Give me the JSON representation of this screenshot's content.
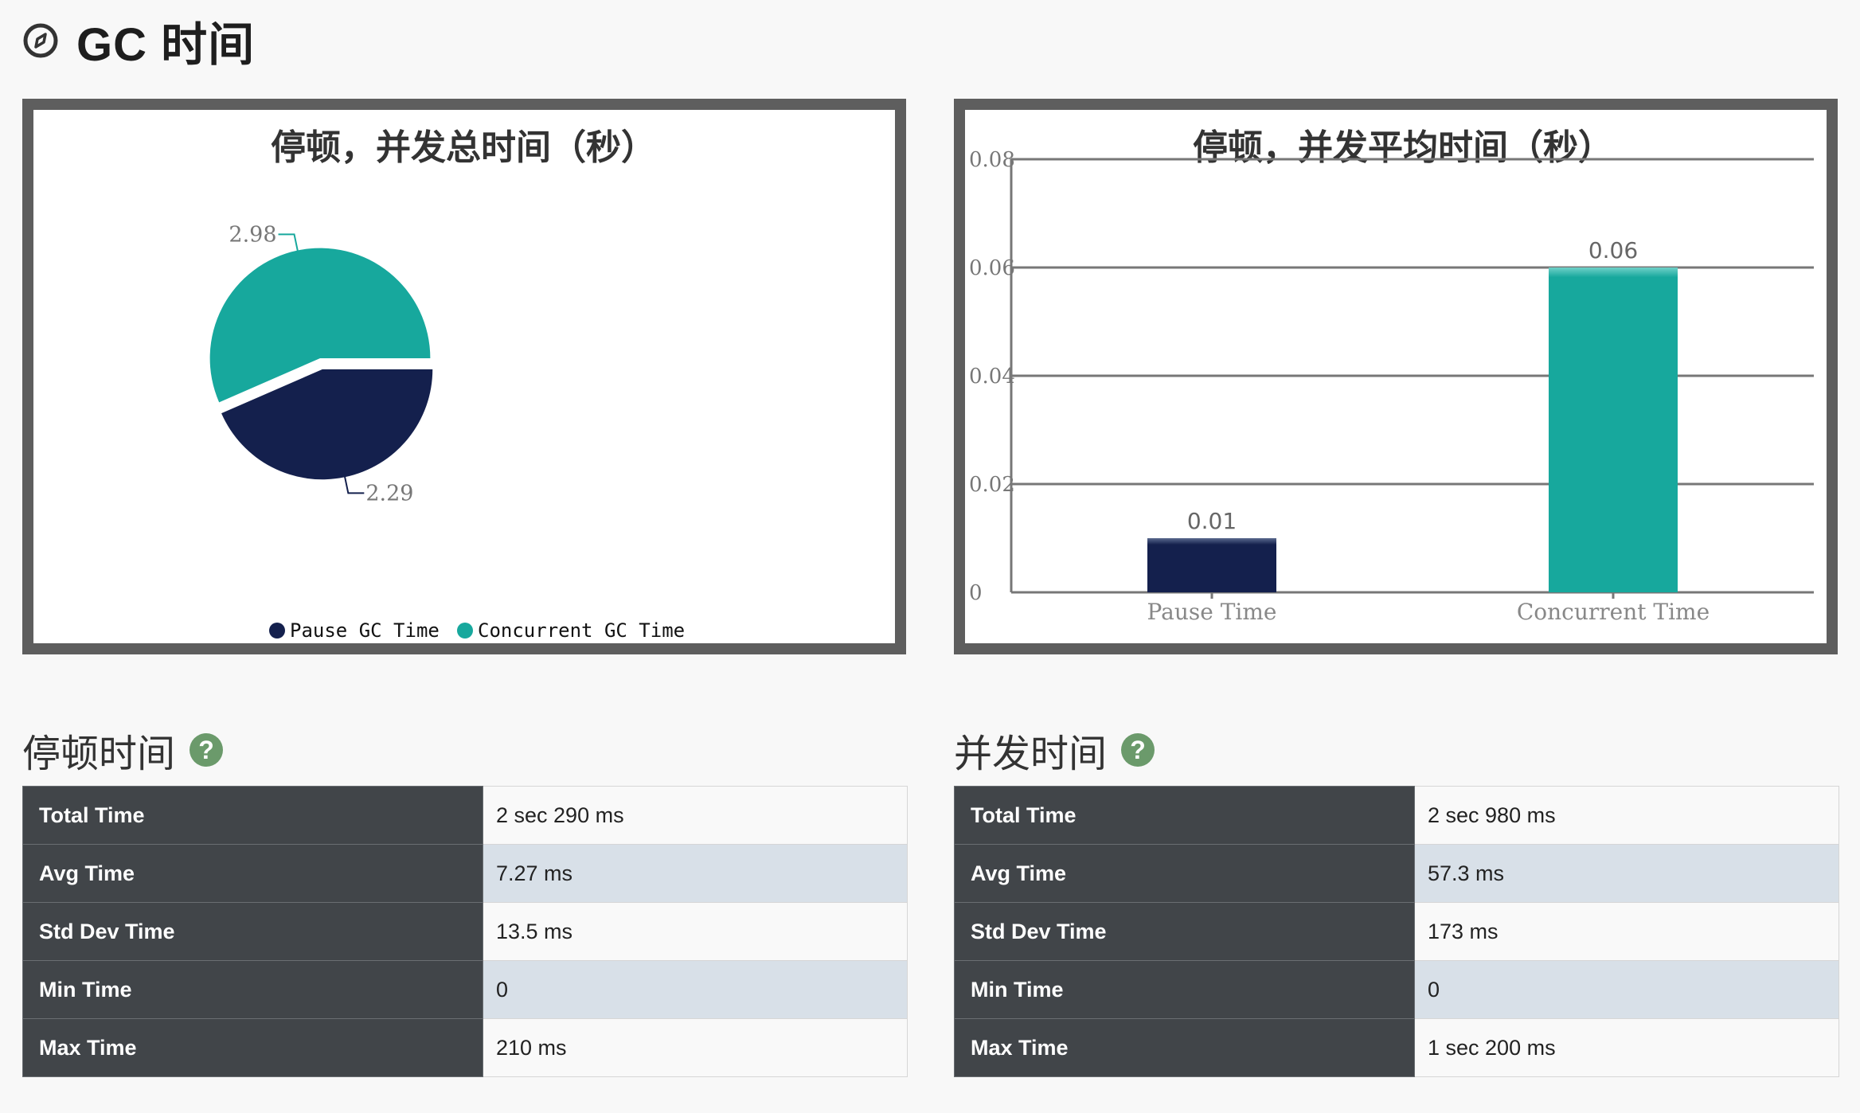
{
  "page": {
    "title": "GC 时间"
  },
  "colors": {
    "pause": "#14204d",
    "concurrent": "#17a89d"
  },
  "chart_data": [
    {
      "type": "pie",
      "title": "停顿，并发总时间（秒）",
      "slices": [
        {
          "name": "Pause GC Time",
          "value": 2.29,
          "label": "2.29",
          "color": "#14204d"
        },
        {
          "name": "Concurrent GC Time",
          "value": 2.98,
          "label": "2.98",
          "color": "#17a89d"
        }
      ],
      "legend": {
        "position": "bottom",
        "items": [
          "Pause GC Time",
          "Concurrent GC Time"
        ]
      }
    },
    {
      "type": "bar",
      "title": "停顿，并发平均时间（秒）",
      "categories": [
        "Pause Time",
        "Concurrent Time"
      ],
      "values": [
        0.01,
        0.06
      ],
      "value_labels": [
        "0.01",
        "0.06"
      ],
      "colors": [
        "#14204d",
        "#17a89d"
      ],
      "ylim": [
        0,
        0.08
      ],
      "yticks": [
        "0",
        "0.02",
        "0.04",
        "0.06",
        "0.08"
      ],
      "grid": true
    }
  ],
  "pause_section": {
    "heading": "停顿时间",
    "help": "?",
    "rows": [
      {
        "key": "Total Time",
        "value": "2 sec 290 ms"
      },
      {
        "key": "Avg Time",
        "value": "7.27 ms"
      },
      {
        "key": "Std Dev Time",
        "value": "13.5 ms"
      },
      {
        "key": "Min Time",
        "value": "0"
      },
      {
        "key": "Max Time",
        "value": "210 ms"
      }
    ]
  },
  "concurrent_section": {
    "heading": "并发时间",
    "help": "?",
    "rows": [
      {
        "key": "Total Time",
        "value": "2 sec 980 ms"
      },
      {
        "key": "Avg Time",
        "value": "57.3 ms"
      },
      {
        "key": "Std Dev Time",
        "value": "173 ms"
      },
      {
        "key": "Min Time",
        "value": "0"
      },
      {
        "key": "Max Time",
        "value": "1 sec 200 ms"
      }
    ]
  }
}
